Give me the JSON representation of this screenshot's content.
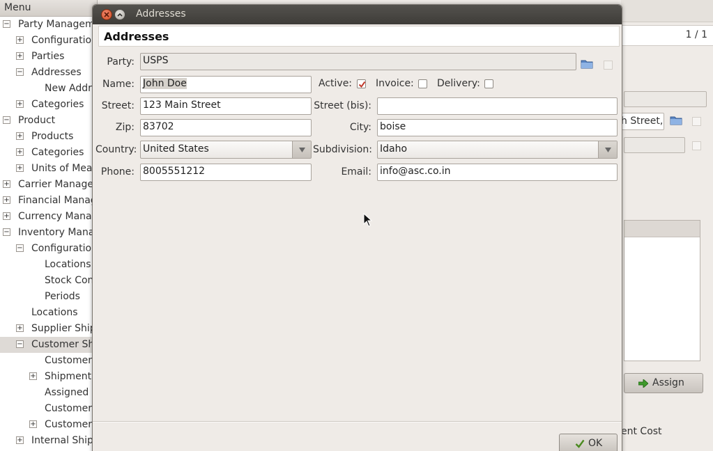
{
  "menu": {
    "header": "Menu",
    "items": [
      {
        "label": "Party Management",
        "level": 0,
        "expander": "−",
        "selected": false
      },
      {
        "label": "Configuration",
        "level": 1,
        "expander": "+",
        "selected": false
      },
      {
        "label": "Parties",
        "level": 1,
        "expander": "+",
        "selected": false
      },
      {
        "label": "Addresses",
        "level": 1,
        "expander": "−",
        "selected": false
      },
      {
        "label": "New Address",
        "level": 2,
        "expander": "",
        "selected": false
      },
      {
        "label": "Categories",
        "level": 1,
        "expander": "+",
        "selected": false
      },
      {
        "label": "Product",
        "level": 0,
        "expander": "−",
        "selected": false
      },
      {
        "label": "Products",
        "level": 1,
        "expander": "+",
        "selected": false
      },
      {
        "label": "Categories",
        "level": 1,
        "expander": "+",
        "selected": false
      },
      {
        "label": "Units of Measure",
        "level": 1,
        "expander": "+",
        "selected": false
      },
      {
        "label": "Carrier Management",
        "level": 0,
        "expander": "+",
        "selected": false
      },
      {
        "label": "Financial Management",
        "level": 0,
        "expander": "+",
        "selected": false
      },
      {
        "label": "Currency Management",
        "level": 0,
        "expander": "+",
        "selected": false
      },
      {
        "label": "Inventory Management",
        "level": 0,
        "expander": "−",
        "selected": false
      },
      {
        "label": "Configuration",
        "level": 1,
        "expander": "−",
        "selected": false
      },
      {
        "label": "Locations",
        "level": 2,
        "expander": "",
        "selected": false
      },
      {
        "label": "Stock Configuration",
        "level": 2,
        "expander": "",
        "selected": false
      },
      {
        "label": "Periods",
        "level": 2,
        "expander": "",
        "selected": false
      },
      {
        "label": "Locations",
        "level": 1,
        "expander": "",
        "selected": false
      },
      {
        "label": "Supplier Shipments",
        "level": 1,
        "expander": "+",
        "selected": false
      },
      {
        "label": "Customer Shipments",
        "level": 1,
        "expander": "−",
        "selected": true
      },
      {
        "label": "Customer",
        "level": 2,
        "expander": "",
        "selected": false
      },
      {
        "label": "Shipment",
        "level": 2,
        "expander": "+",
        "selected": false
      },
      {
        "label": "Assigned Customer",
        "level": 2,
        "expander": "",
        "selected": false
      },
      {
        "label": "Customer",
        "level": 2,
        "expander": "",
        "selected": false
      },
      {
        "label": "Customer",
        "level": 2,
        "expander": "+",
        "selected": false
      },
      {
        "label": "Internal Shipments",
        "level": 1,
        "expander": "+",
        "selected": false
      }
    ]
  },
  "background": {
    "pager": "1 / 1",
    "street_fragment": "h Street,",
    "assign_label": "Assign",
    "cost_fragment": "ent Cost"
  },
  "dialog": {
    "window_title": "Addresses",
    "heading": "Addresses",
    "party": {
      "label": "Party:",
      "value": "USPS"
    },
    "name": {
      "label": "Name:",
      "value": "John Doe"
    },
    "active": {
      "label": "Active:",
      "checked": true
    },
    "invoice": {
      "label": "Invoice:",
      "checked": false
    },
    "delivery": {
      "label": "Delivery:",
      "checked": false
    },
    "street": {
      "label": "Street:",
      "value": "123 Main Street"
    },
    "street_bis": {
      "label": "Street (bis):",
      "value": ""
    },
    "zip": {
      "label": "Zip:",
      "value": "83702"
    },
    "city": {
      "label": "City:",
      "value": "boise"
    },
    "country": {
      "label": "Country:",
      "value": "United States"
    },
    "subdivision": {
      "label": "Subdivision:",
      "value": "Idaho"
    },
    "phone": {
      "label": "Phone:",
      "value": "8005551212"
    },
    "email": {
      "label": "Email:",
      "value": "info@asc.co.in"
    },
    "ok_label": "OK"
  },
  "colors": {
    "check_red": "#c0392b",
    "ok_green": "#4a8a1f",
    "folder_blue": "#5b86c4"
  }
}
